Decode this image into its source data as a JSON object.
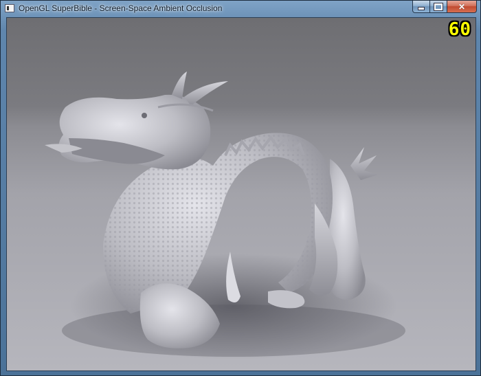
{
  "window": {
    "title": "OpenGL SuperBible - Screen-Space Ambient Occlusion"
  },
  "controls": {
    "minimize_glyph": "",
    "maximize_glyph": "",
    "close_glyph": "✕"
  },
  "viewport": {
    "fps": "60",
    "fps_color": "#ffff00",
    "scene_object": "dragon-model"
  },
  "colors": {
    "titlebar": "#5f86ad",
    "background_top": "#6e6e72",
    "floor": "#b6b6bd",
    "model": "#c8c8ce"
  }
}
